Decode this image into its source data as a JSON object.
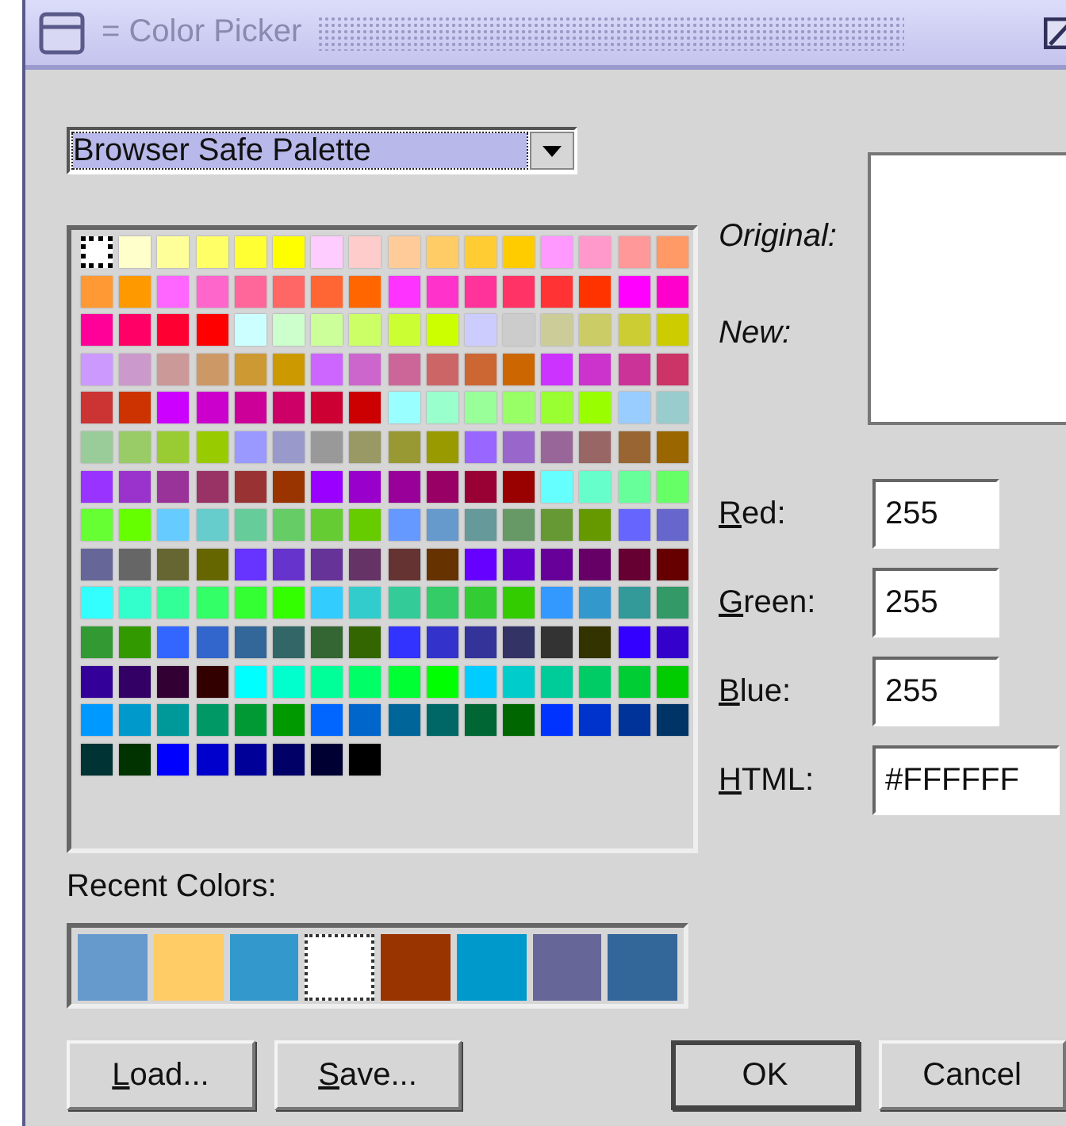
{
  "window": {
    "title": "= Color Picker"
  },
  "palette_menu": {
    "value": "Browser Safe Palette"
  },
  "palette": [
    {
      "color": "#ffffff",
      "selected": true
    },
    {
      "color": "#ffffcc",
      "selected": false
    },
    {
      "color": "#ffff99",
      "selected": false
    },
    {
      "color": "#ffff66",
      "selected": false
    },
    {
      "color": "#ffff33",
      "selected": false
    },
    {
      "color": "#ffff00",
      "selected": false
    },
    {
      "color": "#ffccff",
      "selected": false
    },
    {
      "color": "#ffcccc",
      "selected": false
    },
    {
      "color": "#ffcc99",
      "selected": false
    },
    {
      "color": "#ffcc66",
      "selected": false
    },
    {
      "color": "#ffcc33",
      "selected": false
    },
    {
      "color": "#ffcc00",
      "selected": false
    },
    {
      "color": "#ff99ff",
      "selected": false
    },
    {
      "color": "#ff99cc",
      "selected": false
    },
    {
      "color": "#ff9999",
      "selected": false
    },
    {
      "color": "#ff9966",
      "selected": false
    },
    {
      "color": "#ff9933",
      "selected": false
    },
    {
      "color": "#ff9900",
      "selected": false
    },
    {
      "color": "#ff66ff",
      "selected": false
    },
    {
      "color": "#ff66cc",
      "selected": false
    },
    {
      "color": "#ff6699",
      "selected": false
    },
    {
      "color": "#ff6666",
      "selected": false
    },
    {
      "color": "#ff6633",
      "selected": false
    },
    {
      "color": "#ff6600",
      "selected": false
    },
    {
      "color": "#ff33ff",
      "selected": false
    },
    {
      "color": "#ff33cc",
      "selected": false
    },
    {
      "color": "#ff3399",
      "selected": false
    },
    {
      "color": "#ff3366",
      "selected": false
    },
    {
      "color": "#ff3333",
      "selected": false
    },
    {
      "color": "#ff3300",
      "selected": false
    },
    {
      "color": "#ff00ff",
      "selected": false
    },
    {
      "color": "#ff00cc",
      "selected": false
    },
    {
      "color": "#ff0099",
      "selected": false
    },
    {
      "color": "#ff0066",
      "selected": false
    },
    {
      "color": "#ff0033",
      "selected": false
    },
    {
      "color": "#ff0000",
      "selected": false
    },
    {
      "color": "#ccffff",
      "selected": false
    },
    {
      "color": "#ccffcc",
      "selected": false
    },
    {
      "color": "#ccff99",
      "selected": false
    },
    {
      "color": "#ccff66",
      "selected": false
    },
    {
      "color": "#ccff33",
      "selected": false
    },
    {
      "color": "#ccff00",
      "selected": false
    },
    {
      "color": "#ccccff",
      "selected": false
    },
    {
      "color": "#cccccc",
      "selected": false
    },
    {
      "color": "#cccc99",
      "selected": false
    },
    {
      "color": "#cccc66",
      "selected": false
    },
    {
      "color": "#cccc33",
      "selected": false
    },
    {
      "color": "#cccc00",
      "selected": false
    },
    {
      "color": "#cc99ff",
      "selected": false
    },
    {
      "color": "#cc99cc",
      "selected": false
    },
    {
      "color": "#cc9999",
      "selected": false
    },
    {
      "color": "#cc9966",
      "selected": false
    },
    {
      "color": "#cc9933",
      "selected": false
    },
    {
      "color": "#cc9900",
      "selected": false
    },
    {
      "color": "#cc66ff",
      "selected": false
    },
    {
      "color": "#cc66cc",
      "selected": false
    },
    {
      "color": "#cc6699",
      "selected": false
    },
    {
      "color": "#cc6666",
      "selected": false
    },
    {
      "color": "#cc6633",
      "selected": false
    },
    {
      "color": "#cc6600",
      "selected": false
    },
    {
      "color": "#cc33ff",
      "selected": false
    },
    {
      "color": "#cc33cc",
      "selected": false
    },
    {
      "color": "#cc3399",
      "selected": false
    },
    {
      "color": "#cc3366",
      "selected": false
    },
    {
      "color": "#cc3333",
      "selected": false
    },
    {
      "color": "#cc3300",
      "selected": false
    },
    {
      "color": "#cc00ff",
      "selected": false
    },
    {
      "color": "#cc00cc",
      "selected": false
    },
    {
      "color": "#cc0099",
      "selected": false
    },
    {
      "color": "#cc0066",
      "selected": false
    },
    {
      "color": "#cc0033",
      "selected": false
    },
    {
      "color": "#cc0000",
      "selected": false
    },
    {
      "color": "#99ffff",
      "selected": false
    },
    {
      "color": "#99ffcc",
      "selected": false
    },
    {
      "color": "#99ff99",
      "selected": false
    },
    {
      "color": "#99ff66",
      "selected": false
    },
    {
      "color": "#99ff33",
      "selected": false
    },
    {
      "color": "#99ff00",
      "selected": false
    },
    {
      "color": "#99ccff",
      "selected": false
    },
    {
      "color": "#99cccc",
      "selected": false
    },
    {
      "color": "#99cc99",
      "selected": false
    },
    {
      "color": "#99cc66",
      "selected": false
    },
    {
      "color": "#99cc33",
      "selected": false
    },
    {
      "color": "#99cc00",
      "selected": false
    },
    {
      "color": "#9999ff",
      "selected": false
    },
    {
      "color": "#9999cc",
      "selected": false
    },
    {
      "color": "#999999",
      "selected": false
    },
    {
      "color": "#999966",
      "selected": false
    },
    {
      "color": "#999933",
      "selected": false
    },
    {
      "color": "#999900",
      "selected": false
    },
    {
      "color": "#9966ff",
      "selected": false
    },
    {
      "color": "#9966cc",
      "selected": false
    },
    {
      "color": "#996699",
      "selected": false
    },
    {
      "color": "#996666",
      "selected": false
    },
    {
      "color": "#996633",
      "selected": false
    },
    {
      "color": "#996600",
      "selected": false
    },
    {
      "color": "#9933ff",
      "selected": false
    },
    {
      "color": "#9933cc",
      "selected": false
    },
    {
      "color": "#993399",
      "selected": false
    },
    {
      "color": "#993366",
      "selected": false
    },
    {
      "color": "#993333",
      "selected": false
    },
    {
      "color": "#993300",
      "selected": false
    },
    {
      "color": "#9900ff",
      "selected": false
    },
    {
      "color": "#9900cc",
      "selected": false
    },
    {
      "color": "#990099",
      "selected": false
    },
    {
      "color": "#990066",
      "selected": false
    },
    {
      "color": "#990033",
      "selected": false
    },
    {
      "color": "#990000",
      "selected": false
    },
    {
      "color": "#66ffff",
      "selected": false
    },
    {
      "color": "#66ffcc",
      "selected": false
    },
    {
      "color": "#66ff99",
      "selected": false
    },
    {
      "color": "#66ff66",
      "selected": false
    },
    {
      "color": "#66ff33",
      "selected": false
    },
    {
      "color": "#66ff00",
      "selected": false
    },
    {
      "color": "#66ccff",
      "selected": false
    },
    {
      "color": "#66cccc",
      "selected": false
    },
    {
      "color": "#66cc99",
      "selected": false
    },
    {
      "color": "#66cc66",
      "selected": false
    },
    {
      "color": "#66cc33",
      "selected": false
    },
    {
      "color": "#66cc00",
      "selected": false
    },
    {
      "color": "#6699ff",
      "selected": false
    },
    {
      "color": "#6699cc",
      "selected": false
    },
    {
      "color": "#669999",
      "selected": false
    },
    {
      "color": "#669966",
      "selected": false
    },
    {
      "color": "#669933",
      "selected": false
    },
    {
      "color": "#669900",
      "selected": false
    },
    {
      "color": "#6666ff",
      "selected": false
    },
    {
      "color": "#6666cc",
      "selected": false
    },
    {
      "color": "#666699",
      "selected": false
    },
    {
      "color": "#666666",
      "selected": false
    },
    {
      "color": "#666633",
      "selected": false
    },
    {
      "color": "#666600",
      "selected": false
    },
    {
      "color": "#6633ff",
      "selected": false
    },
    {
      "color": "#6633cc",
      "selected": false
    },
    {
      "color": "#663399",
      "selected": false
    },
    {
      "color": "#663366",
      "selected": false
    },
    {
      "color": "#663333",
      "selected": false
    },
    {
      "color": "#663300",
      "selected": false
    },
    {
      "color": "#6600ff",
      "selected": false
    },
    {
      "color": "#6600cc",
      "selected": false
    },
    {
      "color": "#660099",
      "selected": false
    },
    {
      "color": "#660066",
      "selected": false
    },
    {
      "color": "#660033",
      "selected": false
    },
    {
      "color": "#660000",
      "selected": false
    },
    {
      "color": "#33ffff",
      "selected": false
    },
    {
      "color": "#33ffcc",
      "selected": false
    },
    {
      "color": "#33ff99",
      "selected": false
    },
    {
      "color": "#33ff66",
      "selected": false
    },
    {
      "color": "#33ff33",
      "selected": false
    },
    {
      "color": "#33ff00",
      "selected": false
    },
    {
      "color": "#33ccff",
      "selected": false
    },
    {
      "color": "#33cccc",
      "selected": false
    },
    {
      "color": "#33cc99",
      "selected": false
    },
    {
      "color": "#33cc66",
      "selected": false
    },
    {
      "color": "#33cc33",
      "selected": false
    },
    {
      "color": "#33cc00",
      "selected": false
    },
    {
      "color": "#3399ff",
      "selected": false
    },
    {
      "color": "#3399cc",
      "selected": false
    },
    {
      "color": "#339999",
      "selected": false
    },
    {
      "color": "#339966",
      "selected": false
    },
    {
      "color": "#339933",
      "selected": false
    },
    {
      "color": "#339900",
      "selected": false
    },
    {
      "color": "#3366ff",
      "selected": false
    },
    {
      "color": "#3366cc",
      "selected": false
    },
    {
      "color": "#336699",
      "selected": false
    },
    {
      "color": "#336666",
      "selected": false
    },
    {
      "color": "#336633",
      "selected": false
    },
    {
      "color": "#336600",
      "selected": false
    },
    {
      "color": "#3333ff",
      "selected": false
    },
    {
      "color": "#3333cc",
      "selected": false
    },
    {
      "color": "#333399",
      "selected": false
    },
    {
      "color": "#333366",
      "selected": false
    },
    {
      "color": "#333333",
      "selected": false
    },
    {
      "color": "#333300",
      "selected": false
    },
    {
      "color": "#3300ff",
      "selected": false
    },
    {
      "color": "#3300cc",
      "selected": false
    },
    {
      "color": "#330099",
      "selected": false
    },
    {
      "color": "#330066",
      "selected": false
    },
    {
      "color": "#330033",
      "selected": false
    },
    {
      "color": "#330000",
      "selected": false
    },
    {
      "color": "#00ffff",
      "selected": false
    },
    {
      "color": "#00ffcc",
      "selected": false
    },
    {
      "color": "#00ff99",
      "selected": false
    },
    {
      "color": "#00ff66",
      "selected": false
    },
    {
      "color": "#00ff33",
      "selected": false
    },
    {
      "color": "#00ff00",
      "selected": false
    },
    {
      "color": "#00ccff",
      "selected": false
    },
    {
      "color": "#00cccc",
      "selected": false
    },
    {
      "color": "#00cc99",
      "selected": false
    },
    {
      "color": "#00cc66",
      "selected": false
    },
    {
      "color": "#00cc33",
      "selected": false
    },
    {
      "color": "#00cc00",
      "selected": false
    },
    {
      "color": "#0099ff",
      "selected": false
    },
    {
      "color": "#0099cc",
      "selected": false
    },
    {
      "color": "#009999",
      "selected": false
    },
    {
      "color": "#009966",
      "selected": false
    },
    {
      "color": "#009933",
      "selected": false
    },
    {
      "color": "#009900",
      "selected": false
    },
    {
      "color": "#0066ff",
      "selected": false
    },
    {
      "color": "#0066cc",
      "selected": false
    },
    {
      "color": "#006699",
      "selected": false
    },
    {
      "color": "#006666",
      "selected": false
    },
    {
      "color": "#006633",
      "selected": false
    },
    {
      "color": "#006600",
      "selected": false
    },
    {
      "color": "#0033ff",
      "selected": false
    },
    {
      "color": "#0033cc",
      "selected": false
    },
    {
      "color": "#003399",
      "selected": false
    },
    {
      "color": "#003366",
      "selected": false
    },
    {
      "color": "#003333",
      "selected": false
    },
    {
      "color": "#003300",
      "selected": false
    },
    {
      "color": "#0000ff",
      "selected": false
    },
    {
      "color": "#0000cc",
      "selected": false
    },
    {
      "color": "#000099",
      "selected": false
    },
    {
      "color": "#000066",
      "selected": false
    },
    {
      "color": "#000033",
      "selected": false
    },
    {
      "color": "#000000",
      "selected": false
    }
  ],
  "preview": {
    "original_label": "Original:",
    "new_label": "New:"
  },
  "fields": [
    {
      "label": "Red:",
      "mnemonic": true,
      "value": "255"
    },
    {
      "label": "Green:",
      "mnemonic": true,
      "value": "255"
    },
    {
      "label": "Blue:",
      "mnemonic": true,
      "value": "255"
    },
    {
      "label": "HTML:",
      "mnemonic": true,
      "value": "#FFFFFF"
    }
  ],
  "recent_label": "Recent Colors:",
  "recent_colors": [
    {
      "color": "#6699cc",
      "selected": false
    },
    {
      "color": "#ffcc66",
      "selected": false
    },
    {
      "color": "#3399cc",
      "selected": false
    },
    {
      "color": "#ffffff",
      "selected": true
    },
    {
      "color": "#993300",
      "selected": false
    },
    {
      "color": "#0099cc",
      "selected": false
    },
    {
      "color": "#666699",
      "selected": false
    },
    {
      "color": "#336699",
      "selected": false
    }
  ],
  "buttons": [
    {
      "label": "Load...",
      "mnemonic": true,
      "default": false
    },
    {
      "label": "Save...",
      "mnemonic": true,
      "default": false
    },
    {
      "label": "OK",
      "mnemonic": false,
      "default": true
    },
    {
      "label": "Cancel",
      "mnemonic": false,
      "default": false
    }
  ]
}
